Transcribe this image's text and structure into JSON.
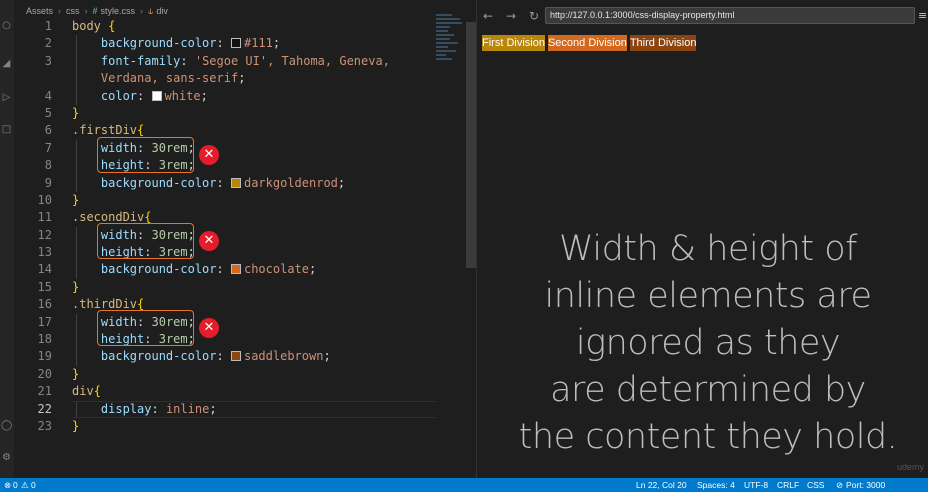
{
  "breadcrumb": {
    "items": [
      "Assets",
      "css",
      "style.css",
      "div"
    ],
    "hash_glyph": "#",
    "symbol_glyph": "⫝"
  },
  "code": {
    "line_numbers": [
      "1",
      "2",
      "3",
      "",
      "4",
      "5",
      "6",
      "7",
      "8",
      "9",
      "10",
      "11",
      "12",
      "13",
      "14",
      "15",
      "16",
      "17",
      "18",
      "19",
      "20",
      "21",
      "22",
      "23"
    ],
    "line1_selector": "body",
    "open_brace": "{",
    "close_brace": "}",
    "line2_prop": "background-color",
    "line2_value": "#111",
    "line3_prop": "font-family",
    "line3_value": "'Segoe UI', Tahoma, Geneva,",
    "line3b_value": "Verdana, sans-serif",
    "line4_prop": "color",
    "line4_value": "white",
    "first_selector": ".firstDiv",
    "second_selector": ".secondDiv",
    "third_selector": ".thirdDiv",
    "width_prop": "width",
    "width_value": "30rem",
    "height_prop": "height",
    "height_value": "3rem",
    "bg_prop": "background-color",
    "first_bg": "darkgoldenrod",
    "second_bg": "chocolate",
    "third_bg": "saddlebrown",
    "div_selector": "div",
    "display_prop": "display",
    "display_value": "inline",
    "colon": ":",
    "semicolon": ";",
    "x_glyph": "✕"
  },
  "colors": {
    "body_bg": "#111111",
    "white": "#ffffff",
    "darkgoldenrod": "#b8860b",
    "chocolate": "#d2691e",
    "saddlebrown": "#8b4513",
    "highlight_box": "#e8742a",
    "x_mark": "#e51c2c",
    "status_bar": "#007acc"
  },
  "browser": {
    "url": "http://127.0.0.1:3000/css-display-property.html",
    "back_icon": "←",
    "forward_icon": "→",
    "reload_icon": "↻",
    "menu_icon": "≡",
    "divs": [
      "First Division",
      "Second Division",
      "Third Division"
    ]
  },
  "overlay": {
    "lines": [
      "Width & height of",
      "inline elements are",
      "ignored as they",
      "are determined by",
      "the content they hold."
    ]
  },
  "watermark": "udemy",
  "status": {
    "problems_icon": "⊗",
    "problems": "0",
    "warnings_icon": "⚠",
    "warnings": "0",
    "position": "Ln 22, Col 20",
    "spaces": "Spaces: 4",
    "encoding": "UTF-8",
    "eol": "CRLF",
    "language": "CSS",
    "port": "Port: 3000",
    "port_icon": "⊘"
  }
}
